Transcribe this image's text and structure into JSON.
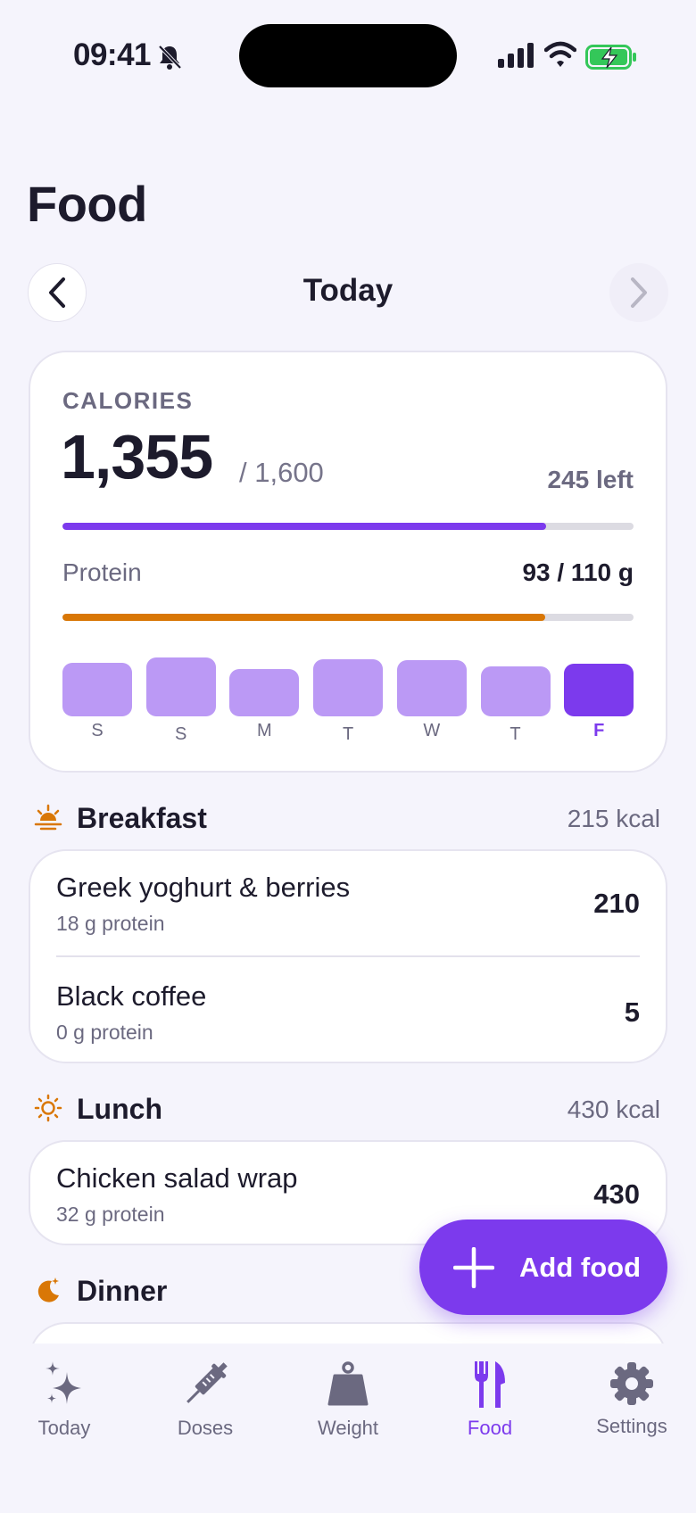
{
  "status_bar": {
    "time": "09:41"
  },
  "page": {
    "title": "Food"
  },
  "date_nav": {
    "label": "Today"
  },
  "calories": {
    "kicker": "CALORIES",
    "consumed": "1,355",
    "target": "/ 1,600",
    "remaining": "245 left",
    "progress_fraction": 0.847,
    "accent_color": "#7c3aed"
  },
  "protein": {
    "label": "Protein",
    "value": "93 / 110 g",
    "progress_fraction": 0.845,
    "accent_color": "#d97706"
  },
  "week": {
    "days": [
      "S",
      "S",
      "M",
      "T",
      "W",
      "T",
      "F"
    ],
    "levels": [
      0.86,
      0.94,
      0.76,
      0.92,
      0.9,
      0.8,
      0.85
    ],
    "today_index": 6
  },
  "meals": {
    "breakfast": {
      "title": "Breakfast",
      "kcal": "215 kcal",
      "items": [
        {
          "name": "Greek yoghurt & berries",
          "protein": "18 g protein",
          "kcal": "210"
        },
        {
          "name": "Black coffee",
          "protein": "0 g protein",
          "kcal": "5"
        }
      ]
    },
    "lunch": {
      "title": "Lunch",
      "kcal": "430 kcal",
      "items": [
        {
          "name": "Chicken salad wrap",
          "protein": "32 g protein",
          "kcal": "430"
        }
      ]
    },
    "dinner": {
      "title": "Dinner"
    }
  },
  "fab": {
    "label": "Add food"
  },
  "tabs": [
    {
      "label": "Today",
      "icon": "sparkles-icon"
    },
    {
      "label": "Doses",
      "icon": "syringe-icon"
    },
    {
      "label": "Weight",
      "icon": "weight-icon"
    },
    {
      "label": "Food",
      "icon": "fork-knife-icon",
      "active": true
    },
    {
      "label": "Settings",
      "icon": "gear-icon"
    }
  ],
  "colors": {
    "accent": "#7c3aed",
    "accent_light": "#bb99f5",
    "orange": "#d97706",
    "text": "#1d1b2c",
    "muted": "#6b6980"
  }
}
